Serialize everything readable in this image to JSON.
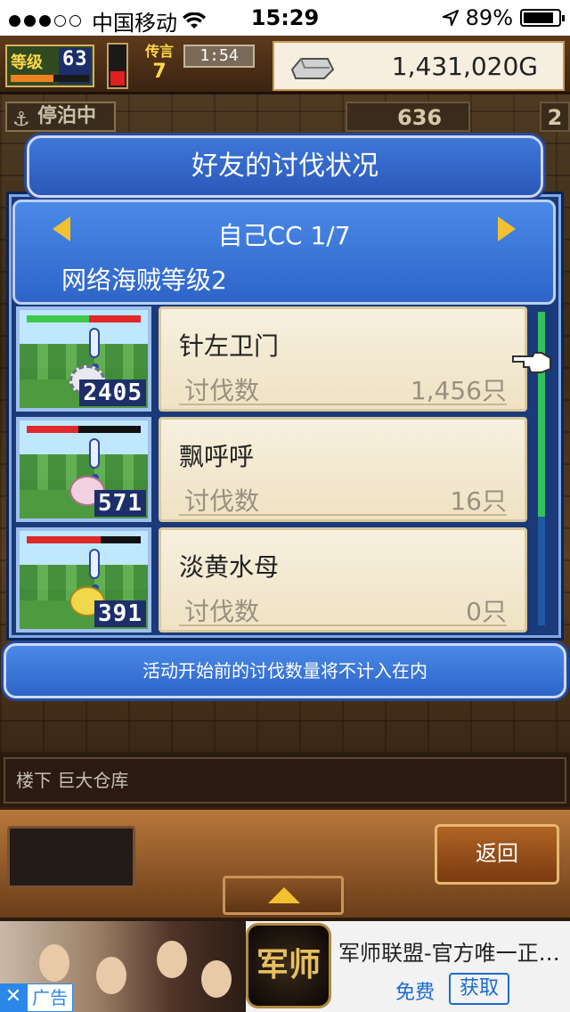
{
  "status_bar": {
    "carrier": "中国移动",
    "time": "15:29",
    "battery": "89%"
  },
  "hud": {
    "level_label": "等级",
    "level": "63",
    "captain_label": "传言",
    "captain_count": "7",
    "timer": "1:54",
    "gold": "1,431,020G"
  },
  "dock": {
    "anchored": "停泊中",
    "stat": "636",
    "stat2": "2"
  },
  "dialog": {
    "title": "好友的讨伐状况",
    "selector": "自己CC 1/7",
    "subtitle": "网络海贼等级2",
    "rows": [
      {
        "name": "针左卫门",
        "label": "讨伐数",
        "count": "1,456只",
        "number": "2405",
        "hp_green": 0.55,
        "hp_red": 0.45,
        "monster_color": "#e8e8f0"
      },
      {
        "name": "飘呼呼",
        "label": "讨伐数",
        "count": "16只",
        "number": "571",
        "hp_green": 0.0,
        "hp_red": 0.45,
        "monster_color": "#f2d0e0"
      },
      {
        "name": "淡黄水母",
        "label": "讨伐数",
        "count": "0只",
        "number": "391",
        "hp_green": 0.0,
        "hp_red": 0.65,
        "monster_color": "#f0d84a"
      }
    ],
    "notice": "活动开始前的讨伐数量将不计入在内"
  },
  "location": "楼下 巨大仓库",
  "buttons": {
    "back": "返回"
  },
  "ad": {
    "tag": "广告",
    "title": "军师联盟-官方唯一正…",
    "free": "免费",
    "get": "获取",
    "logo_text": "军师"
  }
}
